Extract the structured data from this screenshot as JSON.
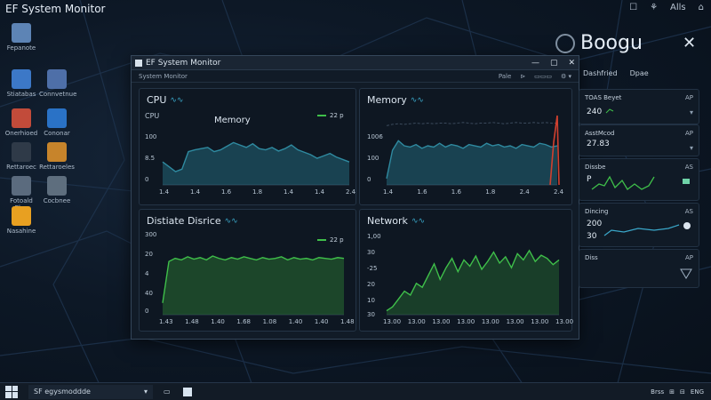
{
  "topbar": {
    "title": "EF System Monitor",
    "tray": [
      "☐",
      "⚘",
      "Alls",
      "⌂"
    ]
  },
  "desktop_icons": [
    {
      "label": "Fepanote",
      "color": "#5d84b5"
    },
    {
      "label": "Stiatabas",
      "color": "#3c78c7"
    },
    {
      "label": "Connvetnue",
      "color": "#4e6fa8"
    },
    {
      "label": "Onerhioed",
      "color": "#c24b3a"
    },
    {
      "label": "Cononar",
      "color": "#2a72c6"
    },
    {
      "label": "Rettaroec",
      "color": "#2f3a48"
    },
    {
      "label": "Rettaroeles",
      "color": "#c7842b"
    },
    {
      "label": "Fotoald Elve",
      "color": "#5b6b7e"
    },
    {
      "label": "Cocbnee",
      "color": "#5e6e7e"
    },
    {
      "label": "Nasahine",
      "color": "#e8a021"
    }
  ],
  "window": {
    "title": "EF System Monitor",
    "menu_left": "System Monitor",
    "menu_right": [
      "Pale",
      "⊳",
      "▭▭▭",
      "⚙ ▾"
    ],
    "controls": [
      "—",
      "▢",
      "✕"
    ]
  },
  "panels": {
    "cpu": {
      "title": "CPU",
      "axis_title": "CPU",
      "inner_label": "Memory",
      "legend": "22 p",
      "yticks": [
        "100",
        "8.5",
        "0"
      ],
      "xticks": [
        "1.4",
        "1.4",
        "1.6",
        "1.8",
        "1.4",
        "1.4",
        "2.4"
      ]
    },
    "memory": {
      "title": "Memory",
      "yticks": [
        "1006",
        "100",
        "0"
      ],
      "xticks": [
        "1.4",
        "1.6",
        "1.6",
        "1.8",
        "2.4",
        "2.4"
      ]
    },
    "disk": {
      "title": "Distiate Disrice",
      "legend": "22 p",
      "yticks": [
        "300",
        "20",
        "4",
        "40",
        "0"
      ],
      "xticks": [
        "1.43",
        "1.48",
        "1.40",
        "1.68",
        "1.08",
        "1.40",
        "1.40",
        "1.48"
      ]
    },
    "network": {
      "title": "Network",
      "yticks": [
        "1,00",
        "30",
        "-25",
        "20",
        "10",
        "30"
      ],
      "xticks": [
        "13.00",
        "13.00",
        "13.00",
        "13.00",
        "13.00",
        "13.00",
        "13.00",
        "13.00"
      ]
    }
  },
  "chart_data": [
    {
      "type": "area",
      "title": "CPU",
      "series": [
        {
          "name": "Memory",
          "values": [
            38,
            30,
            22,
            26,
            55,
            58,
            60,
            62,
            55,
            58,
            64,
            70,
            66,
            62,
            68,
            60,
            58,
            62,
            56,
            60,
            66,
            58,
            54,
            50,
            44,
            48,
            52,
            46,
            42,
            38
          ]
        }
      ],
      "ylim": [
        0,
        100
      ]
    },
    {
      "type": "area",
      "title": "Memory",
      "series": [
        {
          "values": [
            10,
            55,
            70,
            62,
            60,
            64,
            58,
            62,
            60,
            66,
            60,
            64,
            62,
            58,
            64,
            62,
            60,
            66,
            62,
            64,
            60,
            62,
            58,
            64,
            62,
            60,
            66,
            64,
            60,
            62
          ]
        },
        {
          "values": [
            94,
            96,
            97,
            96,
            97,
            98,
            97,
            98,
            97,
            98,
            98,
            97,
            98,
            99,
            98,
            97,
            98,
            98,
            99,
            98,
            97,
            98,
            99,
            98,
            98,
            99,
            98,
            99,
            98,
            98
          ]
        }
      ],
      "ylim": [
        0,
        110
      ]
    },
    {
      "type": "area",
      "title": "Distiate Disrice",
      "series": [
        {
          "name": "22 p",
          "values": [
            15,
            68,
            72,
            70,
            74,
            71,
            73,
            70,
            75,
            72,
            70,
            73,
            71,
            74,
            72,
            70,
            73,
            71,
            72,
            74,
            70,
            73,
            71,
            72,
            70,
            73,
            72,
            71,
            73,
            72
          ]
        }
      ],
      "ylim": [
        0,
        100
      ]
    },
    {
      "type": "area",
      "title": "Network",
      "series": [
        {
          "values": [
            5,
            10,
            20,
            30,
            25,
            40,
            35,
            50,
            65,
            45,
            60,
            72,
            55,
            70,
            62,
            75,
            58,
            68,
            80,
            66,
            74,
            60,
            78,
            70,
            82,
            68,
            76,
            72,
            64,
            70
          ]
        }
      ],
      "ylim": [
        0,
        100
      ]
    }
  ],
  "sidebar": {
    "title": "Boogu",
    "tabs": [
      "Dashfried",
      "Dpae"
    ],
    "cards": [
      {
        "title": "TOAS Beyet",
        "value": "240",
        "right": "AP"
      },
      {
        "title": "AsstMcod",
        "value": "27.83",
        "right": "AP"
      },
      {
        "title": "Dissbe",
        "value": "P",
        "right": "AS"
      },
      {
        "title": "Dincing",
        "value": "200",
        "value2": "30",
        "right": "AS"
      },
      {
        "title": "Diss",
        "value": "",
        "right": "AP"
      }
    ]
  },
  "taskbar": {
    "search_placeholder": "SF egysmoddde",
    "tray": [
      "Brss",
      "⊞",
      "⊟",
      "ENG"
    ]
  }
}
